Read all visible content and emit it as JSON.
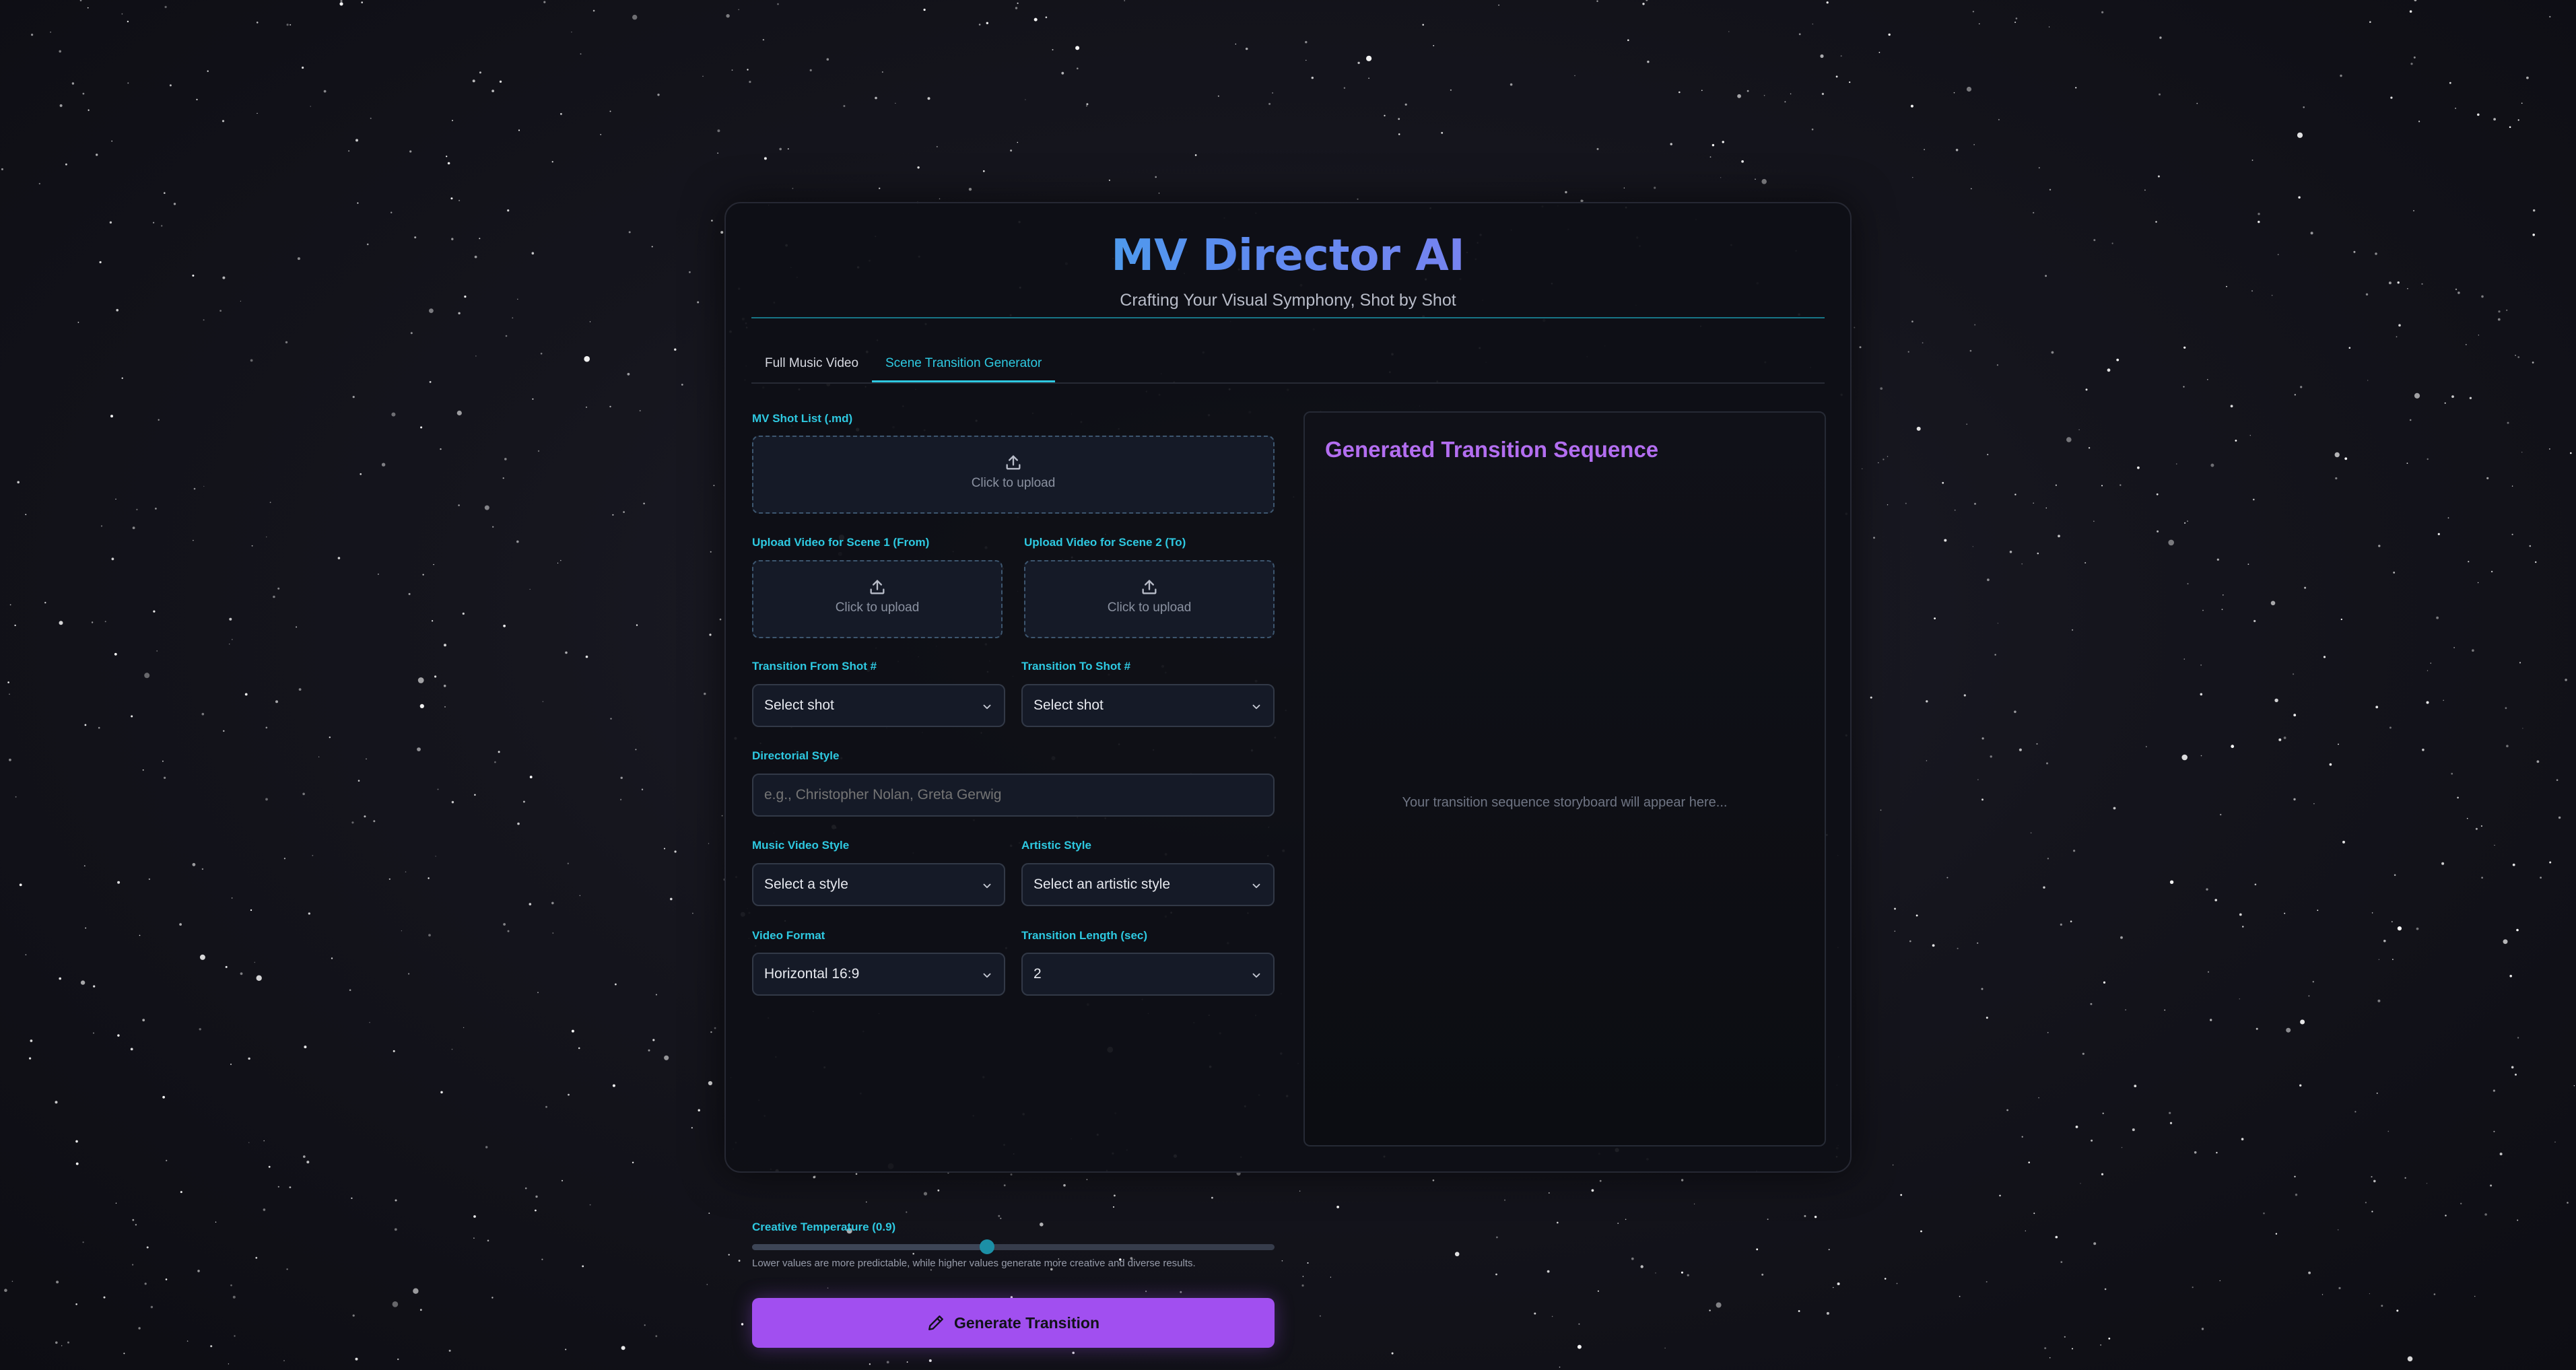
{
  "app": {
    "title": "MV Director AI",
    "subtitle": "Crafting Your Visual Symphony, Shot by Shot"
  },
  "tabs": [
    {
      "label": "Full Music Video",
      "active": false
    },
    {
      "label": "Scene Transition Generator",
      "active": true
    }
  ],
  "form": {
    "shot_list": {
      "label": "MV Shot List (.md)",
      "upload_text": "Click to upload",
      "icon": "upload-icon"
    },
    "scene1_video": {
      "label": "Upload Video for Scene 1 (From)",
      "upload_text": "Click to upload",
      "icon": "upload-icon"
    },
    "scene2_video": {
      "label": "Upload Video for Scene 2 (To)",
      "upload_text": "Click to upload",
      "icon": "upload-icon"
    },
    "from_shot": {
      "label": "Transition From Shot #",
      "value": "Select shot"
    },
    "to_shot": {
      "label": "Transition To Shot #",
      "value": "Select shot"
    },
    "directorial_style": {
      "label": "Directorial Style",
      "value": "",
      "placeholder": "e.g., Christopher Nolan, Greta Gerwig"
    },
    "mv_style": {
      "label": "Music Video Style",
      "value": "Select a style"
    },
    "artistic_style": {
      "label": "Artistic Style",
      "value": "Select an artistic style"
    },
    "video_format": {
      "label": "Video Format",
      "value": "Horizontal 16:9"
    },
    "transition_length": {
      "label": "Transition Length (sec)",
      "value": "2"
    },
    "temperature": {
      "label": "Creative Temperature (0.9)",
      "value": 0.9,
      "min": 0,
      "max": 2,
      "hint": "Lower values are more predictable, while higher values generate more creative and diverse results."
    },
    "generate_button": {
      "label": "Generate Transition",
      "icon": "pencil-icon"
    }
  },
  "output": {
    "title": "Generated Transition Sequence",
    "placeholder": "Your transition sequence storyboard will appear here..."
  },
  "colors": {
    "accent_cyan": "#2ec9e1",
    "accent_purple": "#a14ff0",
    "output_title": "#b36ef0"
  }
}
